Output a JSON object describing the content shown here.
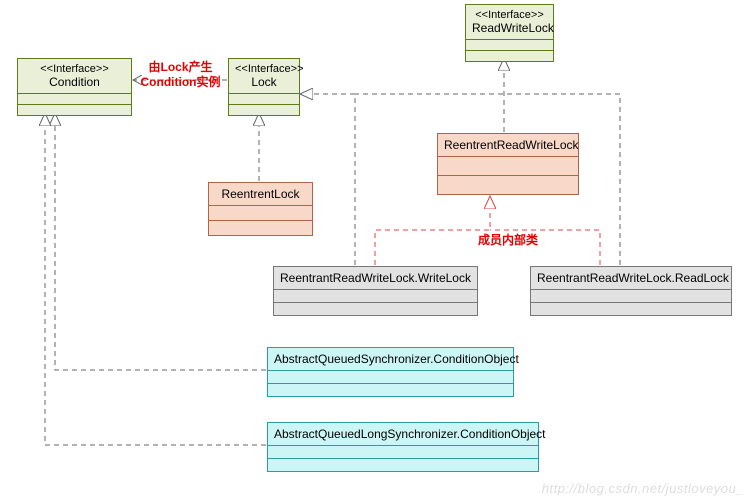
{
  "stereotype": "<<Interface>>",
  "nodes": {
    "condition": "Condition",
    "lock": "Lock",
    "rwlock": "ReadWriteLock",
    "reentrantlock": "ReentrentLock",
    "rrwlock": "ReentrentReadWriteLock",
    "writelock": "ReentrantReadWriteLock.WriteLock",
    "readlock": "ReentrantReadWriteLock.ReadLock",
    "aqs_cond": "AbstractQueuedSynchronizer.ConditionObject",
    "aqls_cond": "AbstractQueuedLongSynchronizer.ConditionObject"
  },
  "annotations": {
    "lock_produces": "由Lock产生\nCondition实例",
    "inner_class": "成员内部类"
  },
  "watermark": "http://blog.csdn.net/justloveyou_",
  "chart_data": {
    "type": "uml_class_diagram",
    "title": "Java Lock / Condition / ReadWriteLock class hierarchy",
    "interfaces": [
      "Condition",
      "Lock",
      "ReadWriteLock"
    ],
    "classes": [
      "ReentrentLock",
      "ReentrentReadWriteLock",
      "ReentrantReadWriteLock.WriteLock",
      "ReentrantReadWriteLock.ReadLock",
      "AbstractQueuedSynchronizer.ConditionObject",
      "AbstractQueuedLongSynchronizer.ConditionObject"
    ],
    "relationships": [
      {
        "from": "ReentrentLock",
        "to": "Lock",
        "kind": "realization"
      },
      {
        "from": "ReentrentReadWriteLock",
        "to": "ReadWriteLock",
        "kind": "realization"
      },
      {
        "from": "ReentrantReadWriteLock.WriteLock",
        "to": "Lock",
        "kind": "realization"
      },
      {
        "from": "ReentrantReadWriteLock.ReadLock",
        "to": "Lock",
        "kind": "realization"
      },
      {
        "from": "AbstractQueuedSynchronizer.ConditionObject",
        "to": "Condition",
        "kind": "realization"
      },
      {
        "from": "AbstractQueuedLongSynchronizer.ConditionObject",
        "to": "Condition",
        "kind": "realization"
      },
      {
        "from": "Lock",
        "to": "Condition",
        "kind": "dependency",
        "note": "由Lock产生Condition实例"
      },
      {
        "from": "ReentrantReadWriteLock.WriteLock",
        "to": "ReentrentReadWriteLock",
        "kind": "inner_class",
        "note": "成员内部类"
      },
      {
        "from": "ReentrantReadWriteLock.ReadLock",
        "to": "ReentrentReadWriteLock",
        "kind": "inner_class",
        "note": "成员内部类"
      }
    ]
  }
}
